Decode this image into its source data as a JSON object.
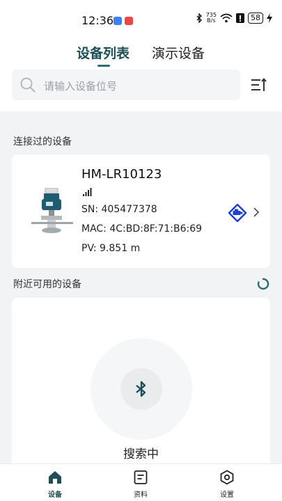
{
  "status_bar": {
    "time": "12:36",
    "net_speed_value": "735",
    "net_speed_unit": "B/s",
    "battery": "58"
  },
  "tabs": {
    "device_list": "设备列表",
    "demo_devices": "演示设备"
  },
  "search": {
    "placeholder": "请输入设备位号"
  },
  "connected": {
    "section_title": "连接过的设备",
    "device": {
      "name": "HM-LR10123",
      "sn": "SN: 405477378",
      "mac": "MAC: 4C:BD:8F:71:B6:69",
      "pv": "PV: 9.851 m"
    }
  },
  "nearby": {
    "section_title": "附近可用的设备",
    "searching_label": "搜索中"
  },
  "bottom_nav": {
    "devices": "设备",
    "docs": "资料",
    "settings": "设置"
  },
  "colors": {
    "accent": "#1e4f56",
    "protocol_blue": "#1f3fd6"
  }
}
